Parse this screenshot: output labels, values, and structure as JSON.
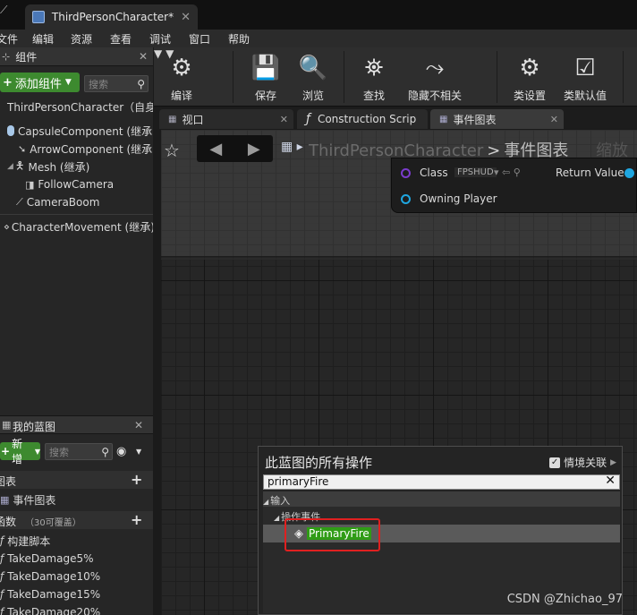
{
  "window": {
    "doc_tab": "ThirdPersonCharacter*"
  },
  "menu": [
    "文件",
    "编辑",
    "资源",
    "查看",
    "调试",
    "窗口",
    "帮助"
  ],
  "components_panel": {
    "title": "组件",
    "add_button": "添加组件",
    "search_placeholder": "搜索",
    "root": "ThirdPersonCharacter（自身",
    "items": [
      {
        "label": "CapsuleComponent (继承)",
        "icon": "capsule-icon"
      },
      {
        "label": "ArrowComponent (继承)",
        "icon": "arrow-icon"
      },
      {
        "label": "Mesh (继承)",
        "icon": "mesh-icon"
      },
      {
        "label": "FollowCamera",
        "icon": "camera-icon"
      },
      {
        "label": "CameraBoom",
        "icon": "spring-arm-icon"
      },
      {
        "label": "CharacterMovement (继承)",
        "icon": "movement-icon"
      }
    ]
  },
  "my_blueprint": {
    "title": "我的蓝图",
    "new_button": "新增",
    "search_placeholder": "搜索",
    "graphs_header": "图表",
    "event_graph": "事件图表",
    "functions_header": "函数",
    "functions_note": "（30可覆盖）",
    "functions": [
      "构建脚本",
      "TakeDamage5%",
      "TakeDamage10%",
      "TakeDamage15%",
      "TakeDamage20%"
    ]
  },
  "toolbar": {
    "compile": "编译",
    "save": "保存",
    "browse": "浏览",
    "find": "查找",
    "hide_unrelated": "隐藏不相关",
    "class_settings": "类设置",
    "class_defaults": "类默认值"
  },
  "editor_tabs": [
    "视口",
    "Construction Scrip",
    "事件图表"
  ],
  "graph": {
    "breadcrumb_root": "ThirdPersonCharacter",
    "breadcrumb_current": "事件图表",
    "zoom_text": "缩放",
    "node": {
      "class_label": "Class",
      "class_value": "FPSHUD",
      "return_label": "Return Value",
      "owning_player": "Owning Player"
    }
  },
  "action_menu": {
    "title": "此蓝图的所有操作",
    "context_sensitive": "情境关联",
    "search_value": "primaryFire",
    "category_input": "输入",
    "category_action_events": "操作事件",
    "result": "PrimaryFire"
  },
  "watermark": "CSDN @Zhichao_97",
  "colors": {
    "accent_green": "#2f9c15",
    "highlight_red": "#e02020",
    "add_button": "#3d8a2f"
  }
}
